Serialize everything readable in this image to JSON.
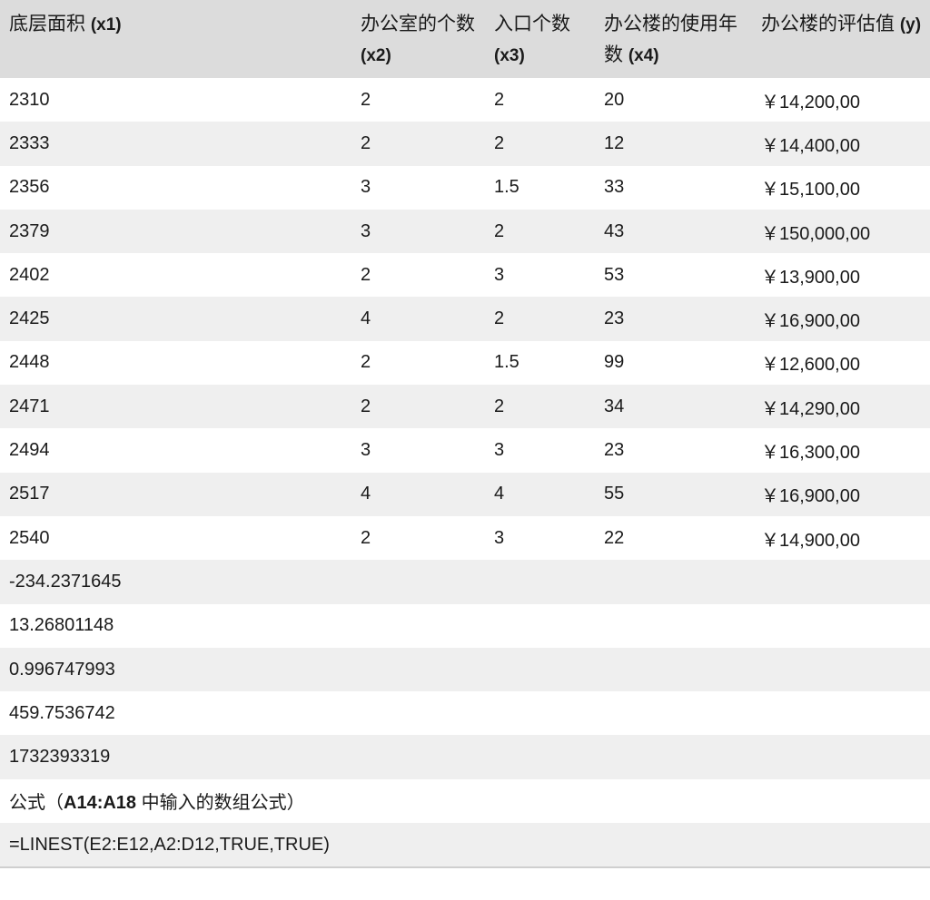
{
  "headers": [
    {
      "label": "底层面积",
      "code": "(x1)"
    },
    {
      "label": "办公室的个数",
      "code": "(x2)"
    },
    {
      "label": "入口个数",
      "code": "(x3)"
    },
    {
      "label": "办公楼的使用年数",
      "code": "(x4)"
    },
    {
      "label": "办公楼的评估值",
      "code": "(y)"
    }
  ],
  "rows": [
    [
      "2310",
      "2",
      "2",
      "20",
      "￥14,200,00"
    ],
    [
      "2333",
      "2",
      "2",
      "12",
      "￥14,400,00"
    ],
    [
      "2356",
      "3",
      "1.5",
      "33",
      "￥15,100,00"
    ],
    [
      "2379",
      "3",
      "2",
      "43",
      "￥150,000,00"
    ],
    [
      "2402",
      "2",
      "3",
      "53",
      "￥13,900,00"
    ],
    [
      "2425",
      "4",
      "2",
      "23",
      "￥16,900,00"
    ],
    [
      "2448",
      "2",
      "1.5",
      "99",
      "￥12,600,00"
    ],
    [
      "2471",
      "2",
      "2",
      "34",
      "￥14,290,00"
    ],
    [
      "2494",
      "3",
      "3",
      "23",
      "￥16,300,00"
    ],
    [
      "2517",
      "4",
      "4",
      "55",
      "￥16,900,00"
    ],
    [
      "2540",
      "2",
      "3",
      "22",
      "￥14,900,00"
    ]
  ],
  "results": [
    "-234.2371645",
    "13.26801148",
    "0.996747993",
    "459.7536742",
    "1732393319"
  ],
  "note": {
    "prefix": "公式（",
    "range": "A14:A18",
    "suffix": " 中输入的数组公式）"
  },
  "formula": "=LINEST(E2:E12,A2:D12,TRUE,TRUE)"
}
